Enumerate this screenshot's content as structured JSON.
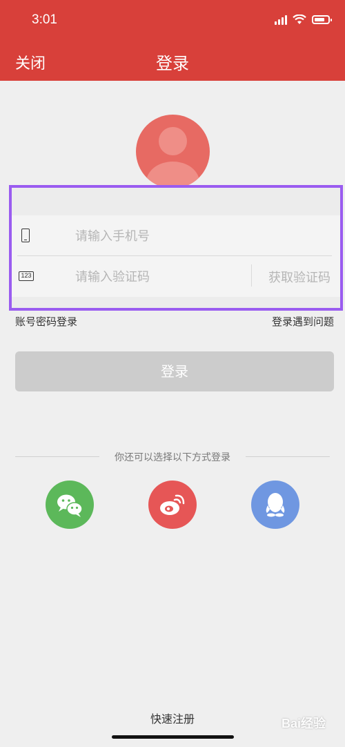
{
  "status_bar": {
    "time": "3:01"
  },
  "header": {
    "close_label": "关闭",
    "title": "登录"
  },
  "form": {
    "phone_placeholder": "请输入手机号",
    "code_placeholder": "请输入验证码",
    "get_code_label": "获取验证码",
    "code_icon_text": "123"
  },
  "links": {
    "account_login": "账号密码登录",
    "problem": "登录遇到问题"
  },
  "login_button": "登录",
  "alt_login_text": "你还可以选择以下方式登录",
  "social": [
    "wechat-icon",
    "weibo-icon",
    "qq-icon"
  ],
  "register_label": "快速注册",
  "watermark": "Bai经验",
  "colors": {
    "brand": "#d8403a",
    "highlight_box": "#9a5cf0",
    "wechat": "#5cb85a",
    "weibo": "#e65656",
    "qq": "#6f97e1"
  }
}
